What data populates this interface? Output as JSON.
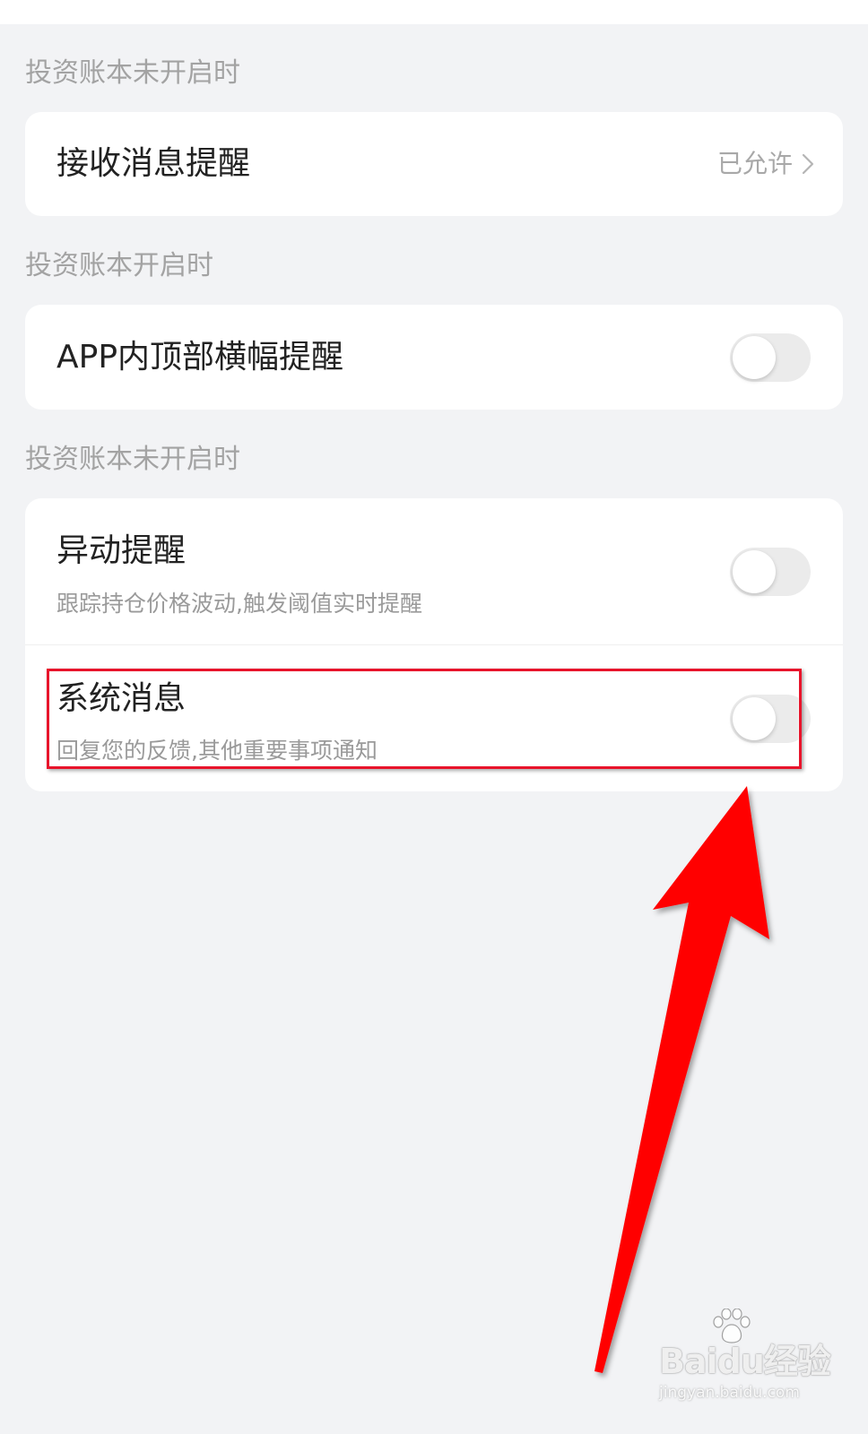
{
  "sections": [
    {
      "header": "投资账本未开启时",
      "rows": [
        {
          "title": "接收消息提醒",
          "value": "已允许",
          "icon": "chevron-right-icon"
        }
      ]
    },
    {
      "header": "投资账本开启时",
      "rows": [
        {
          "title": "APP内顶部横幅提醒",
          "toggle_on": false
        }
      ]
    },
    {
      "header": "投资账本未开启时",
      "rows": [
        {
          "title": "异动提醒",
          "subtitle": "跟踪持仓价格波动,触发阈值实时提醒",
          "toggle_on": false
        },
        {
          "title": "系统消息",
          "subtitle": "回复您的反馈,其他重要事项通知",
          "toggle_on": false
        }
      ]
    }
  ],
  "annotation": {
    "highlight_color": "#e8142b",
    "arrow_color": "#ff0000",
    "highlight_target": "系统消息"
  },
  "watermark": {
    "brand": "Baidu经验",
    "url": "jingyan.baidu.com",
    "icon": "paw-icon"
  },
  "colors": {
    "background": "#f2f3f5",
    "card": "#ffffff",
    "toggle_off": "#ebebeb"
  }
}
